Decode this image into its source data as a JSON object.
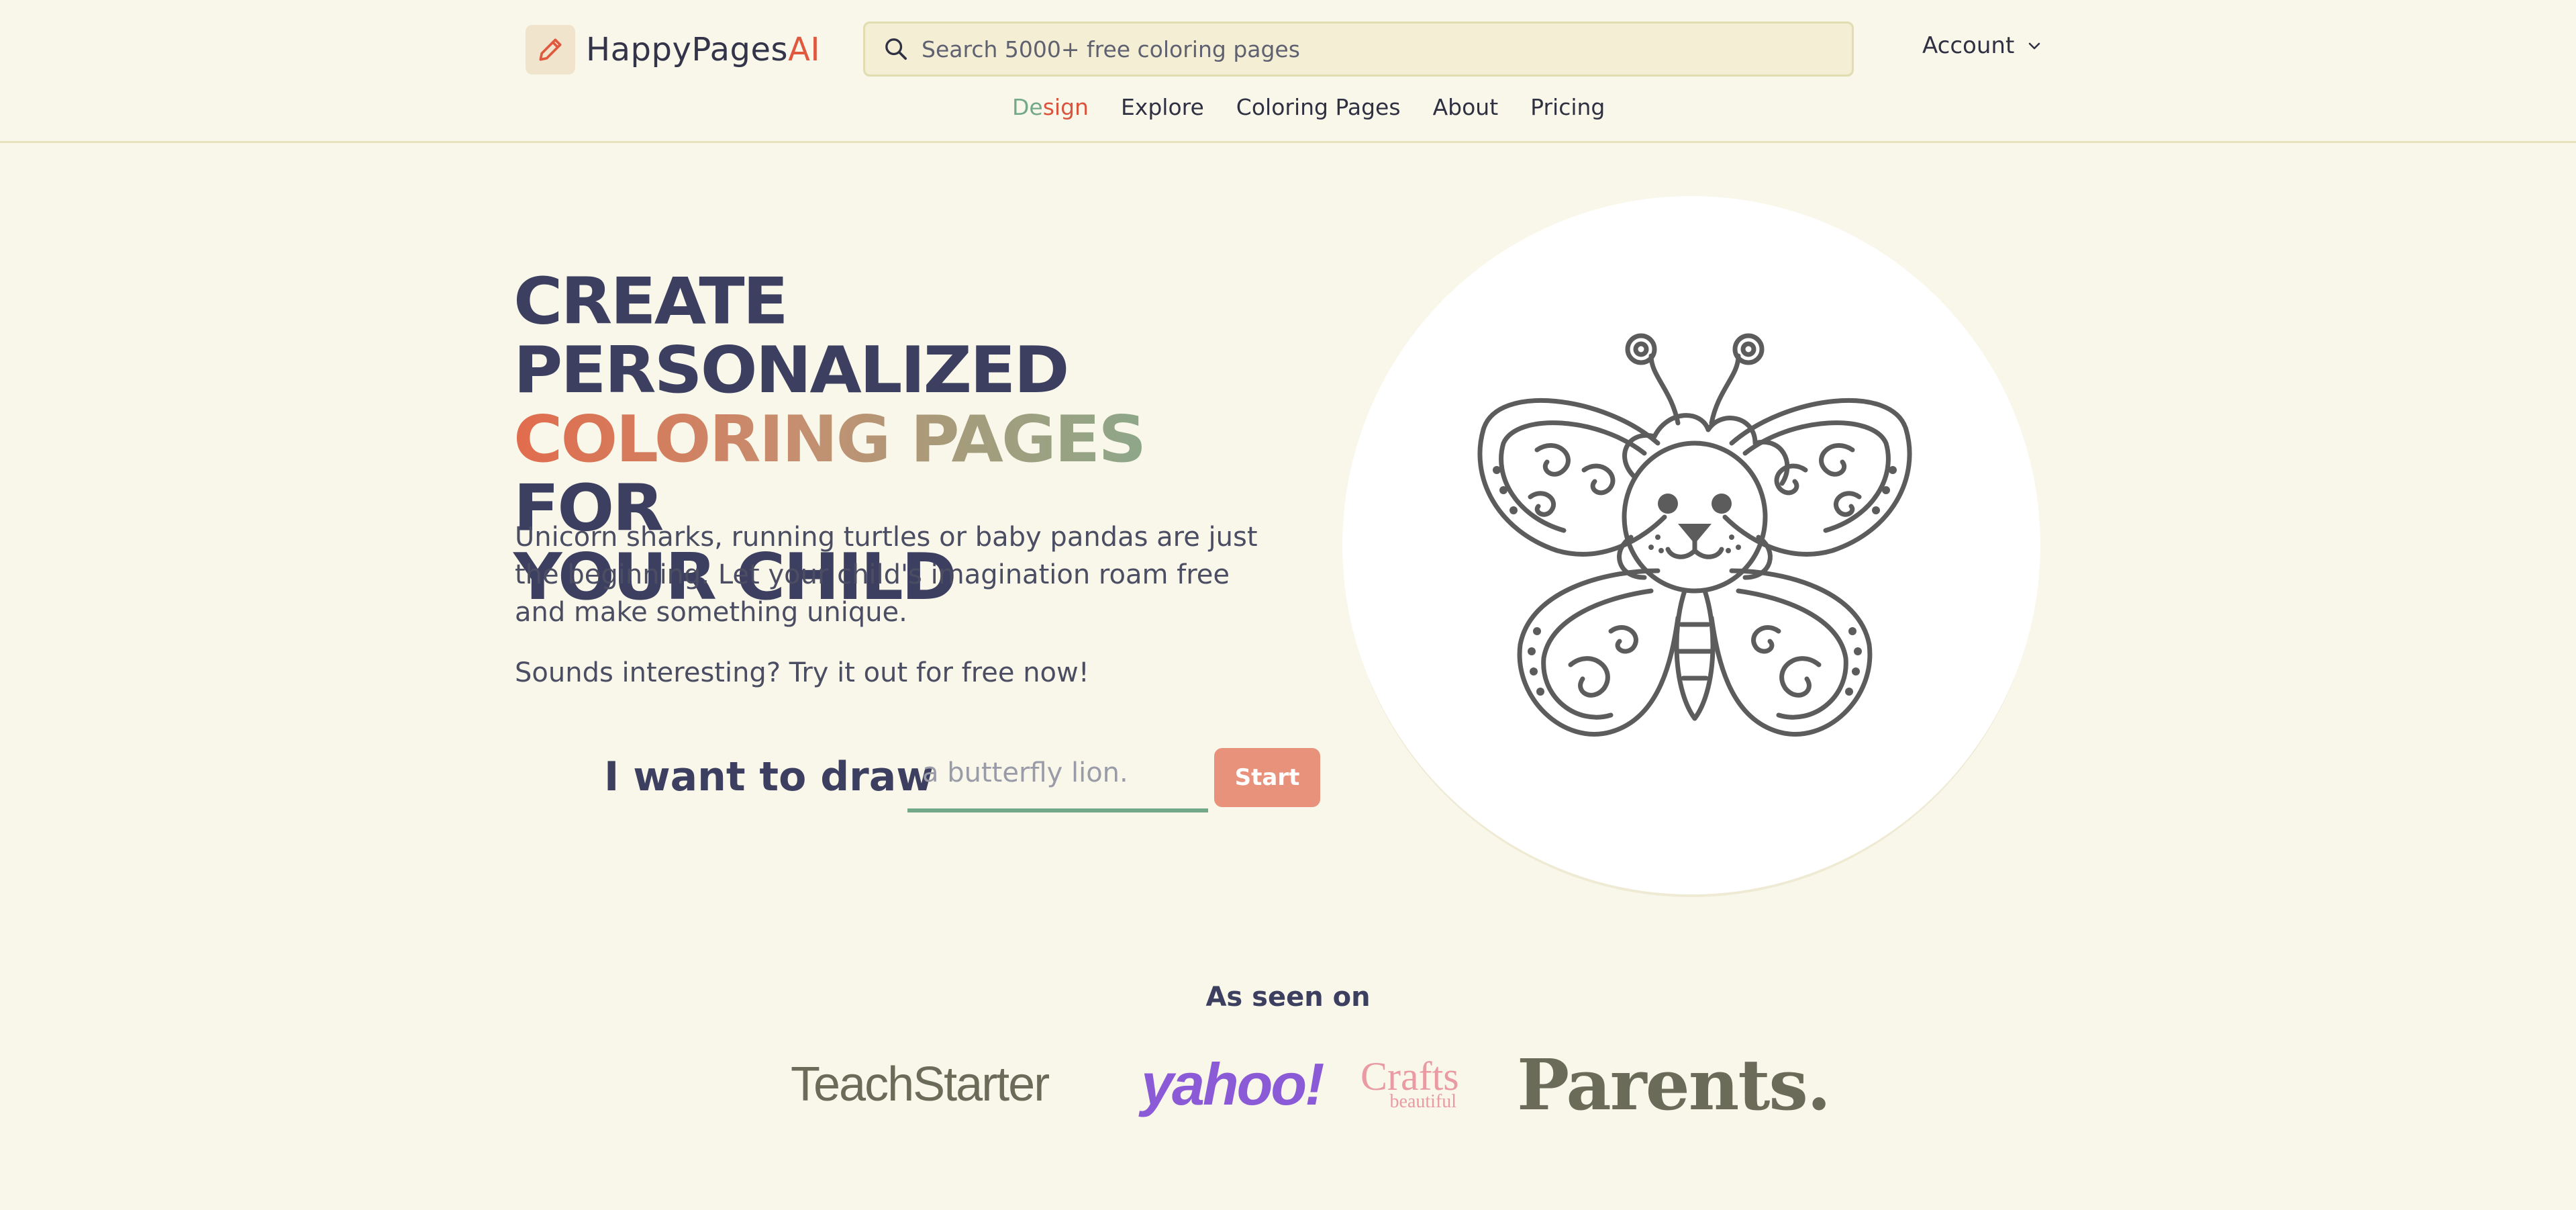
{
  "header": {
    "logo": {
      "text_main": "HappyPages",
      "text_accent": "AI",
      "icon": "pencil-icon"
    },
    "search": {
      "placeholder": "Search 5000+ free coloring pages",
      "icon": "search-icon"
    },
    "account": {
      "label": "Account",
      "icon": "chevron-down-icon"
    },
    "nav": {
      "design_part1": "De",
      "design_part2": "sign",
      "items": [
        "Explore",
        "Coloring Pages",
        "About",
        "Pricing"
      ]
    }
  },
  "hero": {
    "headline_line1": "Create Personalized",
    "headline_coloring": "Coloring",
    "headline_pages": "Pages",
    "headline_for": "for",
    "headline_line3": "your child",
    "lead": "Unicorn sharks, running turtles or baby pandas are just the beginning. Let your child's imagination roam free and make something unique.",
    "sub": "Sounds interesting? Try it out for free now!",
    "draw_label": "I want to draw",
    "draw_placeholder": "a butterfly lion.",
    "start_label": "Start",
    "image": "butterfly-lion-coloring-page"
  },
  "press": {
    "title": "As seen on",
    "logos": {
      "teachstarter": "TeachStarter",
      "yahoo": "yahoo!",
      "crafts_big": "Crafts",
      "crafts_small": "beautiful",
      "parents": "Parents."
    }
  },
  "colors": {
    "background": "#f9f7ea",
    "accent_orange": "#e0583e",
    "accent_green": "#73a98a",
    "button": "#e8927c",
    "text_dark": "#3c3f5f"
  }
}
